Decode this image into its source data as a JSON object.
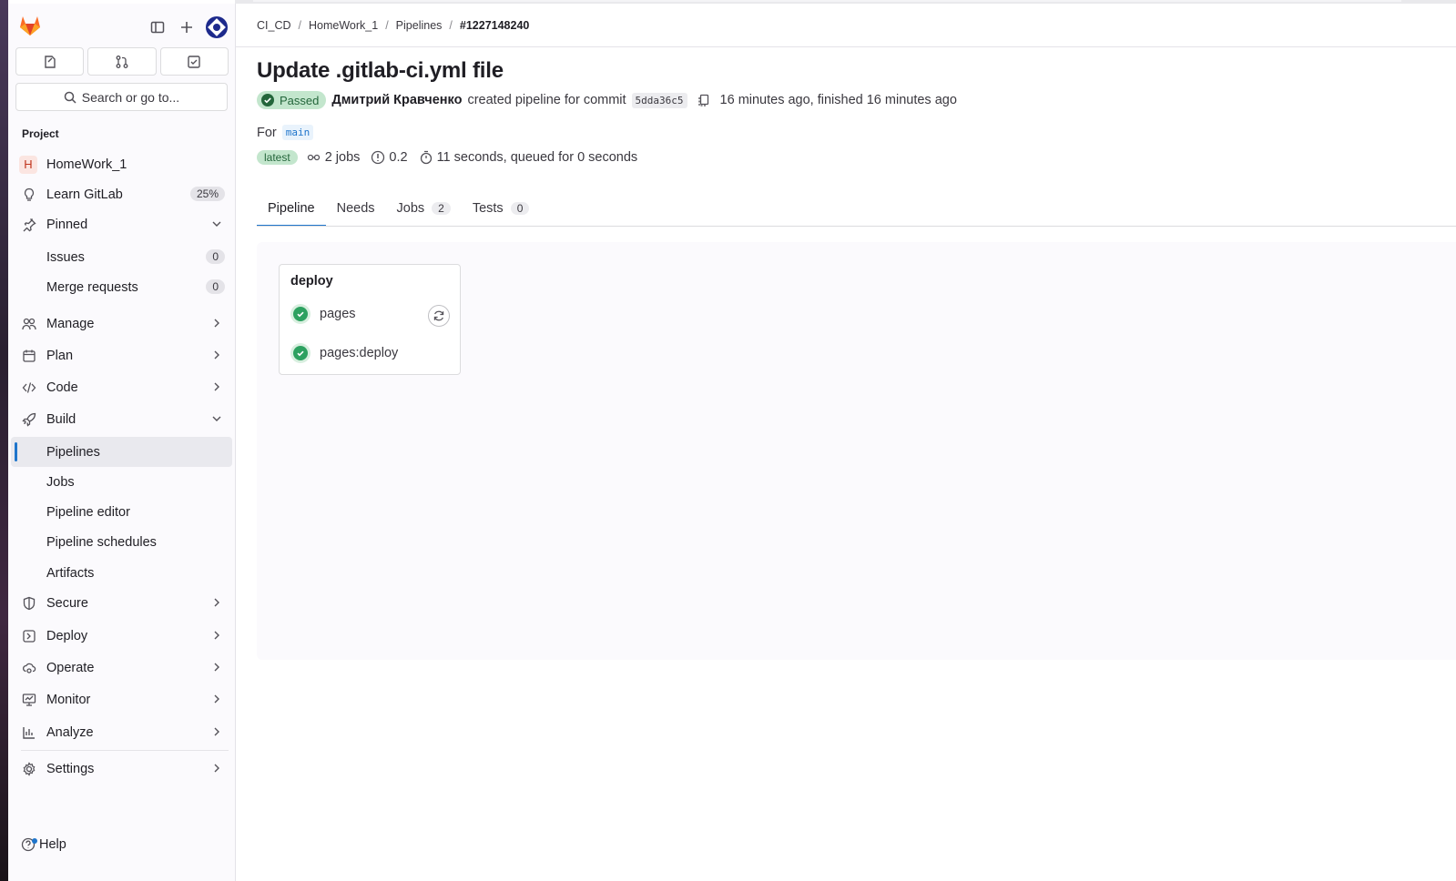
{
  "header": {
    "search_placeholder": "Search or go to..."
  },
  "sidebar": {
    "section_label": "Project",
    "project": {
      "initial": "H",
      "name": "HomeWork_1"
    },
    "learn": {
      "label": "Learn GitLab",
      "percent": "25%"
    },
    "pinned": {
      "label": "Pinned",
      "items": [
        {
          "label": "Issues",
          "count": "0"
        },
        {
          "label": "Merge requests",
          "count": "0"
        }
      ]
    },
    "manage": "Manage",
    "plan": "Plan",
    "code": "Code",
    "build": {
      "label": "Build",
      "items": [
        "Pipelines",
        "Jobs",
        "Pipeline editor",
        "Pipeline schedules",
        "Artifacts"
      ]
    },
    "secure": "Secure",
    "deploy": "Deploy",
    "operate": "Operate",
    "monitor": "Monitor",
    "analyze": "Analyze",
    "settings": "Settings",
    "help": "Help"
  },
  "breadcrumb": [
    "CI_CD",
    "HomeWork_1",
    "Pipelines",
    "#1227148240"
  ],
  "pipeline": {
    "title": "Update .gitlab-ci.yml file",
    "status": "Passed",
    "author": "Дмитрий Кравченко",
    "created_text": "created pipeline for commit",
    "sha": "5dda36c5",
    "time_text": "16 minutes ago, finished 16 minutes ago",
    "for_label": "For",
    "branch": "main",
    "latest_badge": "latest",
    "jobs_text": "2 jobs",
    "coverage": "0.2",
    "duration_text": "11 seconds, queued for 0 seconds"
  },
  "tabs": [
    {
      "label": "Pipeline"
    },
    {
      "label": "Needs"
    },
    {
      "label": "Jobs",
      "count": "2"
    },
    {
      "label": "Tests",
      "count": "0"
    }
  ],
  "stage": {
    "name": "deploy",
    "jobs": [
      {
        "name": "pages",
        "status": "success"
      },
      {
        "name": "pages:deploy",
        "status": "success"
      }
    ]
  },
  "colors": {
    "accent": "#1f75cb",
    "success": "#2da160",
    "brand": "#e24329"
  }
}
